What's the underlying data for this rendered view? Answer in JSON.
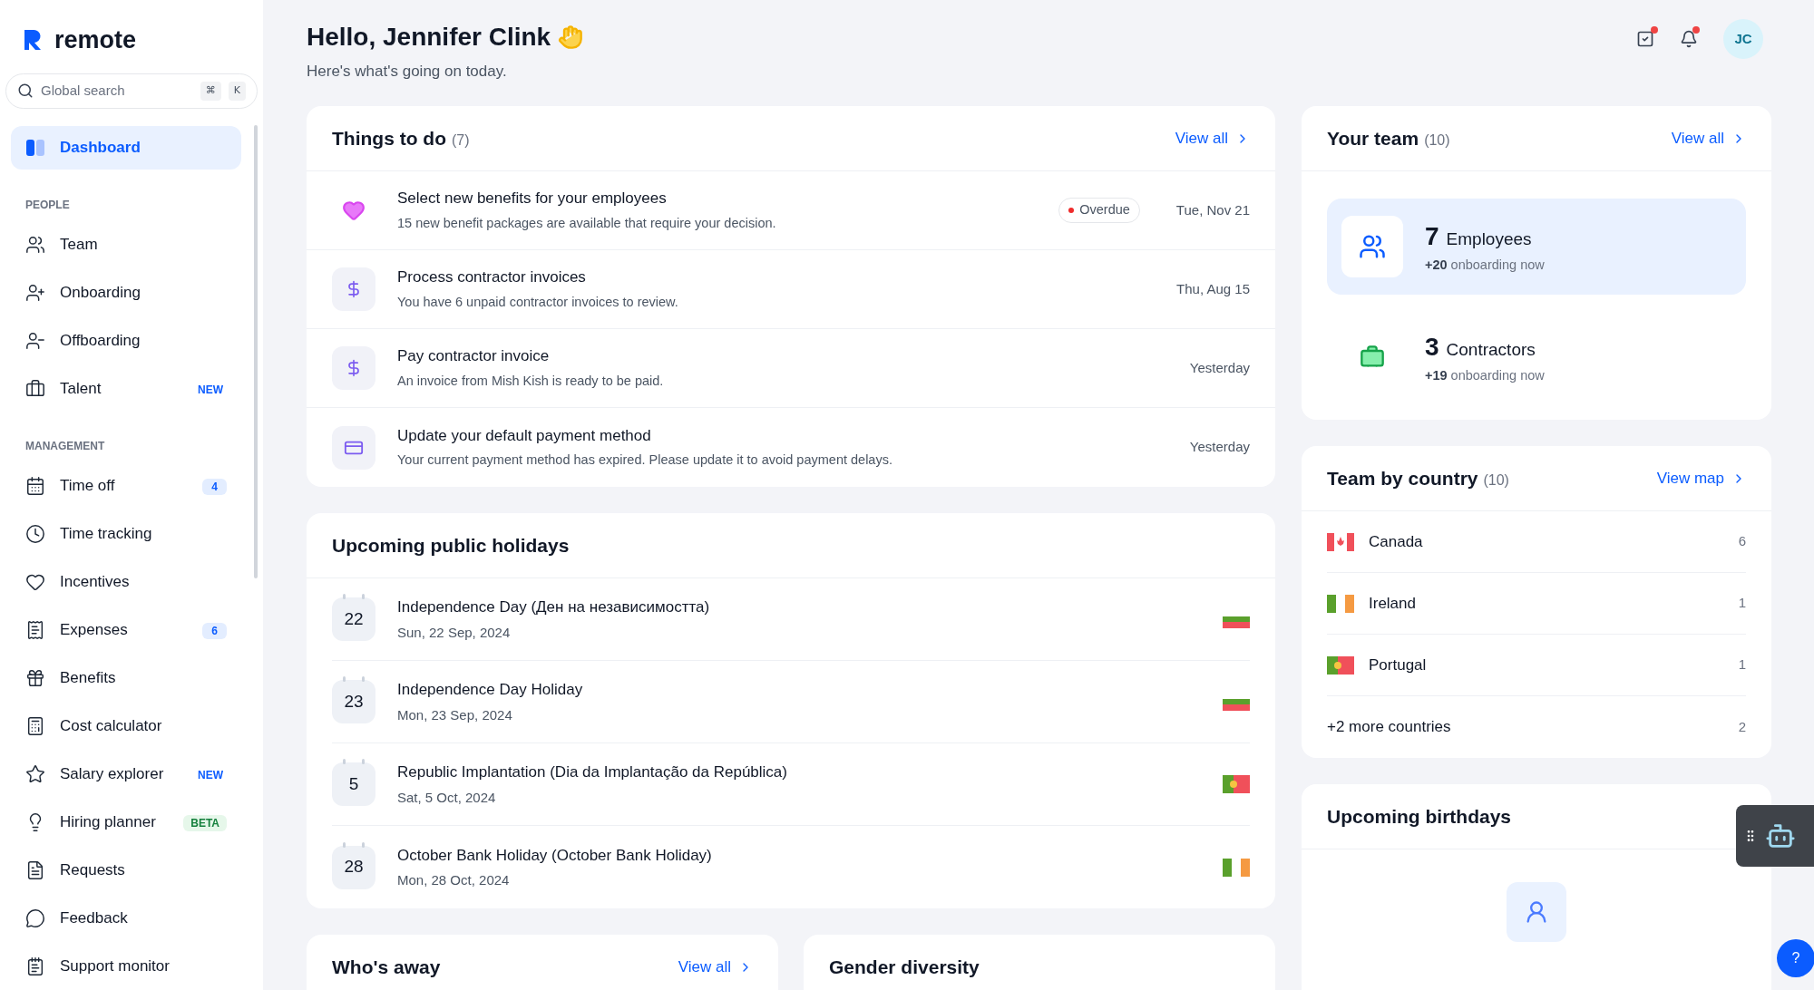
{
  "brand": {
    "name": "remote"
  },
  "search": {
    "placeholder": "Global search",
    "keys": [
      "⌘",
      "K"
    ]
  },
  "sidebar": {
    "items": [
      {
        "label": "Dashboard",
        "kind": "dashboard",
        "selected": true
      },
      {
        "section": "PEOPLE"
      },
      {
        "label": "Team",
        "kind": "team",
        "selected": false
      },
      {
        "label": "Onboarding",
        "kind": "onboarding",
        "selected": false
      },
      {
        "label": "Offboarding",
        "kind": "offboarding",
        "selected": false
      },
      {
        "label": "Talent",
        "kind": "talent",
        "selected": false,
        "badge": {
          "text": "NEW",
          "kind": "new"
        }
      },
      {
        "section": "MANAGEMENT"
      },
      {
        "label": "Time off",
        "kind": "timeoff",
        "selected": false,
        "badge": {
          "text": "4",
          "kind": "count"
        }
      },
      {
        "label": "Time tracking",
        "kind": "clock",
        "selected": false
      },
      {
        "label": "Incentives",
        "kind": "heart",
        "selected": false
      },
      {
        "label": "Expenses",
        "kind": "receipt",
        "selected": false,
        "badge": {
          "text": "6",
          "kind": "count"
        }
      },
      {
        "label": "Benefits",
        "kind": "gift",
        "selected": false
      },
      {
        "label": "Cost calculator",
        "kind": "calculator",
        "selected": false
      },
      {
        "label": "Salary explorer",
        "kind": "star",
        "selected": false,
        "badge": {
          "text": "NEW",
          "kind": "new"
        }
      },
      {
        "label": "Hiring planner",
        "kind": "bulb",
        "selected": false,
        "badge": {
          "text": "BETA",
          "kind": "beta"
        }
      },
      {
        "label": "Requests",
        "kind": "requests",
        "selected": false
      },
      {
        "label": "Feedback",
        "kind": "feedback",
        "selected": false
      },
      {
        "label": "Support monitor",
        "kind": "support",
        "selected": false
      }
    ]
  },
  "header": {
    "greeting": "Hello, Jennifer Clink",
    "subtitle": "Here's what's going on today.",
    "avatar": "JC"
  },
  "todo": {
    "title": "Things to do",
    "count": "(7)",
    "link": "View all",
    "items": [
      {
        "kind": "heart",
        "title": "Select new benefits for your employees",
        "text": "15 new benefit packages are available that require your decision.",
        "status": "Overdue",
        "date": "Tue, Nov 21"
      },
      {
        "kind": "invoice",
        "title": "Process contractor invoices",
        "text": "You have 6 unpaid contractor invoices to review.",
        "date": "Thu, Aug 15"
      },
      {
        "kind": "invoice",
        "title": "Pay contractor invoice",
        "text": "An invoice from Mish Kish is ready to be paid.",
        "date": "Yesterday"
      },
      {
        "kind": "card",
        "title": "Update your default payment method",
        "text": "Your current payment method has expired. Please update it to avoid payment delays.",
        "date": "Yesterday"
      }
    ]
  },
  "holidays": {
    "title": "Upcoming public holidays",
    "items": [
      {
        "day": "22",
        "name": "Independence Day (Ден на независимостта)",
        "date": "Sun, 22 Sep, 2024",
        "kind": "bg"
      },
      {
        "day": "23",
        "name": "Independence Day Holiday",
        "date": "Mon, 23 Sep, 2024",
        "kind": "bg"
      },
      {
        "day": "5",
        "name": "Republic Implantation (Dia da Implantação da República)",
        "date": "Sat, 5 Oct, 2024",
        "kind": "pt"
      },
      {
        "day": "28",
        "name": "October Bank Holiday (October Bank Holiday)",
        "date": "Mon, 28 Oct, 2024",
        "kind": "ie"
      }
    ]
  },
  "whos_away": {
    "title": "Who's away",
    "link": "View all"
  },
  "gender": {
    "title": "Gender diversity"
  },
  "team": {
    "title": "Your team",
    "count": "(10)",
    "link": "View all",
    "groups": [
      {
        "kind": "employees",
        "number": "7",
        "label": "Employees",
        "delta": "+20",
        "note": "onboarding now",
        "selected": true
      },
      {
        "kind": "contractors",
        "number": "3",
        "label": "Contractors",
        "delta": "+19",
        "note": "onboarding now",
        "selected": false
      }
    ]
  },
  "countries": {
    "title": "Team by country",
    "count": "(10)",
    "link": "View map",
    "items": [
      {
        "kind": "ca",
        "name": "Canada",
        "count": "6"
      },
      {
        "kind": "ie",
        "name": "Ireland",
        "count": "1"
      },
      {
        "kind": "pt",
        "name": "Portugal",
        "count": "1"
      },
      {
        "name": "+2 more countries",
        "count": "2"
      }
    ]
  },
  "birthdays": {
    "title": "Upcoming birthdays"
  },
  "help": {
    "label": "?"
  }
}
